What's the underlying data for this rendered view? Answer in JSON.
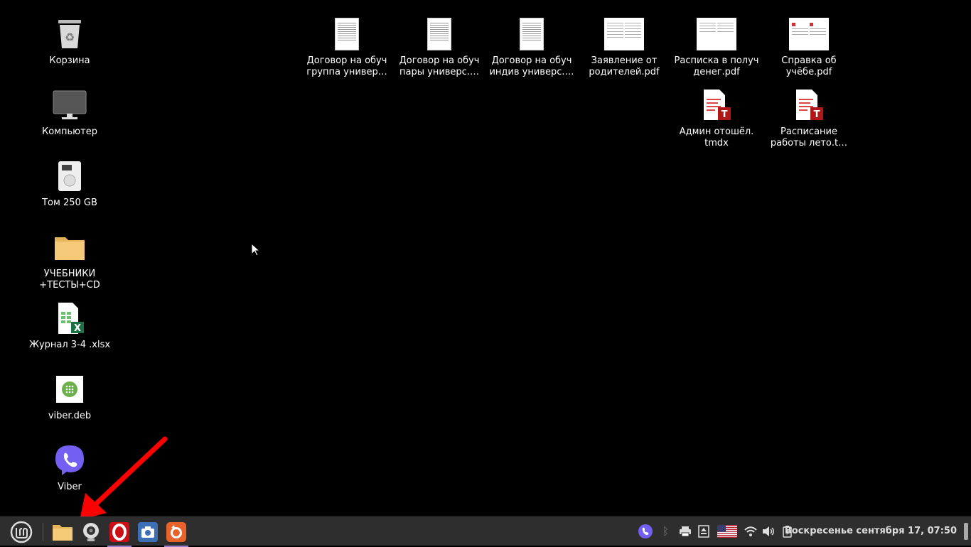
{
  "desktop": {
    "left_icons": [
      {
        "label": "Корзина"
      },
      {
        "label": "Компьютер"
      },
      {
        "label": "Том 250 GB"
      },
      {
        "label": "УЧЕБНИКИ\n+ТЕСТЫ+CD"
      },
      {
        "label": "Журнал 3-4 .xlsx"
      },
      {
        "label": "viber.deb"
      },
      {
        "label": "Viber"
      }
    ],
    "top_icons": [
      {
        "label": "Договор на обуч\nгруппа универ…"
      },
      {
        "label": "Договор на обуч\nпары универс.…"
      },
      {
        "label": "Договор на обуч\nиндив универс.…"
      },
      {
        "label": "Заявление от\nродителей.pdf"
      },
      {
        "label": "Расписка в получ\nденег.pdf"
      },
      {
        "label": "Справка об\nучёбе.pdf"
      },
      {
        "label": "Админ отошёл.\ntmdx"
      },
      {
        "label": "Расписание\nработы лето.t…"
      }
    ]
  },
  "taskbar": {
    "clock": "Воскресенье сентября 17, 07:50",
    "apps": [
      {
        "name": "files-icon"
      },
      {
        "name": "webcam-icon"
      },
      {
        "name": "opera-icon"
      },
      {
        "name": "screenshot-icon"
      },
      {
        "name": "firefox-icon"
      }
    ]
  },
  "colors": {
    "accent": "#9a7fd1",
    "arrow": "#ff0000",
    "viber": "#7360f2"
  }
}
